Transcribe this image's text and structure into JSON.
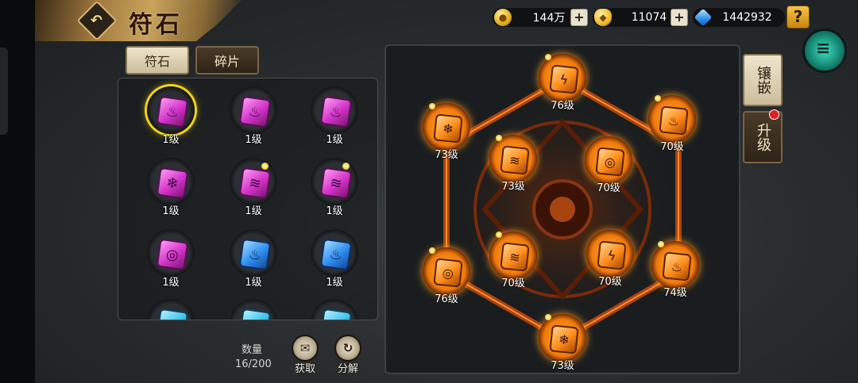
{
  "header": {
    "title": "符石",
    "back_icon": "return-arrow-icon"
  },
  "currencies": [
    {
      "name": "gold-coin",
      "icon": "gold-coin-icon",
      "value": "144万"
    },
    {
      "name": "gold-ingot",
      "icon": "gold-ingot-icon",
      "value": "11074"
    },
    {
      "name": "diamond",
      "icon": "diamond-icon",
      "value": "1442932"
    }
  ],
  "help_label": "?",
  "tabs": {
    "runes": "符石",
    "fragments": "碎片"
  },
  "grid": {
    "slots": [
      {
        "level": "1级",
        "color": "purple",
        "icon": "flame-icon",
        "selected": true,
        "star": false
      },
      {
        "level": "1级",
        "color": "purple",
        "icon": "flame-icon",
        "selected": false,
        "star": false
      },
      {
        "level": "1级",
        "color": "purple",
        "icon": "flame-icon",
        "selected": false,
        "star": false
      },
      {
        "level": "1级",
        "color": "purple",
        "icon": "snowflake-icon",
        "selected": false,
        "star": false
      },
      {
        "level": "1级",
        "color": "purple",
        "icon": "claw-icon",
        "selected": false,
        "star": true
      },
      {
        "level": "1级",
        "color": "purple",
        "icon": "claw-icon",
        "selected": false,
        "star": true
      },
      {
        "level": "1级",
        "color": "purple",
        "icon": "tornado-icon",
        "selected": false,
        "star": false
      },
      {
        "level": "1级",
        "color": "blue",
        "icon": "flame-icon",
        "selected": false,
        "star": false
      },
      {
        "level": "1级",
        "color": "blue",
        "icon": "flame-icon",
        "selected": false,
        "star": false
      }
    ]
  },
  "footer": {
    "count_label": "数量",
    "count_value": "16/200",
    "obtain_label": "获取",
    "decompose_label": "分解"
  },
  "array": {
    "nodes": [
      {
        "level": "76级",
        "icon": "lightning-icon",
        "star": true
      },
      {
        "level": "73级",
        "icon": "snowflake-icon",
        "star": true
      },
      {
        "level": "70级",
        "icon": "flame-icon",
        "star": true
      },
      {
        "level": "73级",
        "icon": "claw-icon",
        "star": true
      },
      {
        "level": "70级",
        "icon": "tornado-icon",
        "star": false
      },
      {
        "level": "70级",
        "icon": "claw-icon",
        "star": true
      },
      {
        "level": "70级",
        "icon": "lightning-icon",
        "star": false
      },
      {
        "level": "76级",
        "icon": "tornado-icon",
        "star": true
      },
      {
        "level": "74级",
        "icon": "flame-icon",
        "star": true
      },
      {
        "level": "73级",
        "icon": "snowflake-icon",
        "star": true
      }
    ],
    "center_icon": "bagua-icon"
  },
  "side_tabs": {
    "inlay": "镶嵌",
    "upgrade": "升级"
  },
  "colors": {
    "accent_gold": "#f2d21a",
    "node_orange": "#f07a0c",
    "notify_red": "#e21f1f"
  }
}
